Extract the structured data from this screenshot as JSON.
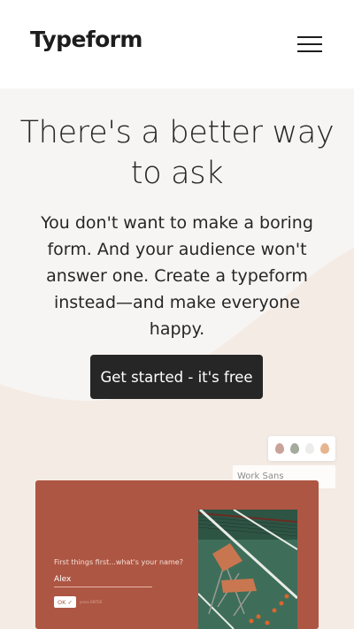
{
  "header": {
    "logo_text": "Typeform",
    "menu_icon": "hamburger-menu-icon"
  },
  "hero": {
    "headline": "There's a better way to ask",
    "subtext": "You don't want to make a boring form. And your audience won't answer one. Create a typeform instead—and make everyone happy.",
    "cta_label": "Get started - it's free"
  },
  "preview": {
    "font_name": "Work Sans",
    "palette_colors": [
      "#c9a39a",
      "#a5ab9c",
      "#ececea",
      "#e6b58f"
    ],
    "accent_color": "#ad5643",
    "question": "First things first...what's your name?",
    "answer": "Alex",
    "ok_label": "OK ✓",
    "enter_hint": "press ENTER"
  },
  "colors": {
    "hero_background": "#f4ebe5",
    "button": "#262627",
    "text": "#262627"
  }
}
